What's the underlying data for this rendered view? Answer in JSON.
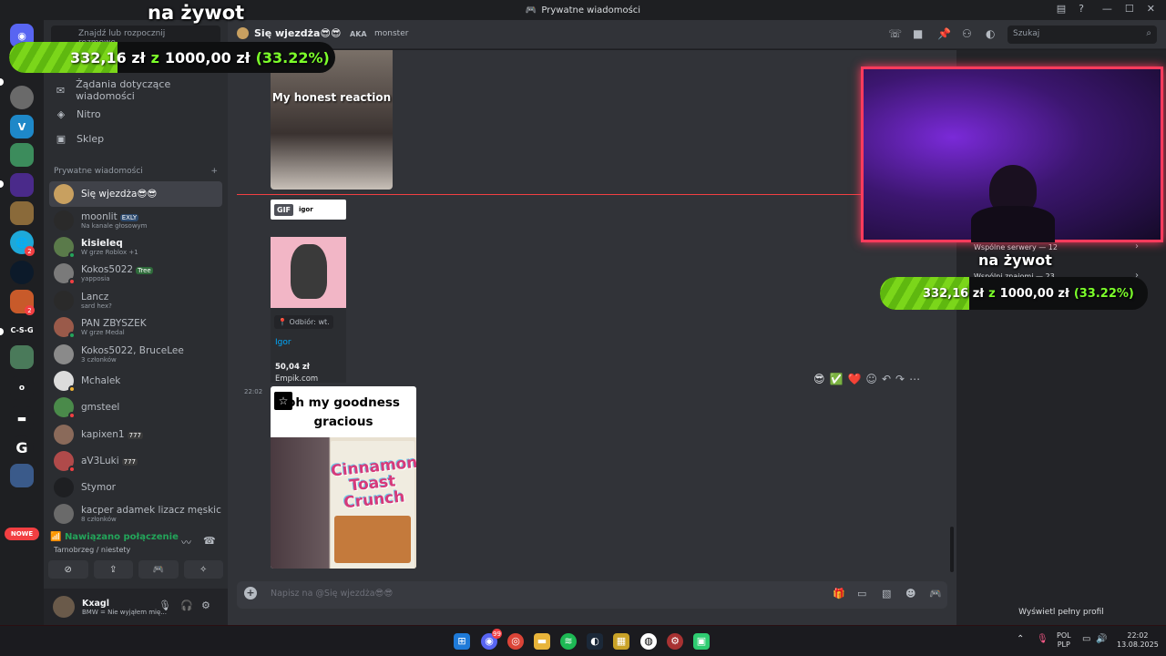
{
  "window": {
    "title": "Prywatne wiadomości"
  },
  "sidebar": {
    "search_placeholder": "Znajdź lub rozpocznij rozmowę",
    "nav": [
      {
        "label": "Żądania dotyczące wiadomości"
      },
      {
        "label": "Nitro"
      },
      {
        "label": "Sklep"
      }
    ],
    "section_title": "Prywatne wiadomości",
    "add_icon": "+",
    "dms": [
      {
        "name": "Się wjezdża😎😎",
        "sub": ""
      },
      {
        "name": "moonlit",
        "tag": "EXLY",
        "sub": "Na kanale głosowym"
      },
      {
        "name": "kisieleq",
        "sub": "W grze Roblox +1"
      },
      {
        "name": "Kokos5022",
        "tag": "Tree",
        "sub": "yapposia"
      },
      {
        "name": "Lancz",
        "sub": "sard hex?"
      },
      {
        "name": "PAN ZBYSZEK",
        "sub": "W grze Medal"
      },
      {
        "name": "Kokos5022, BruceLee",
        "sub": "3 członków"
      },
      {
        "name": "Mchalek",
        "sub": ""
      },
      {
        "name": "gmsteel",
        "sub": ""
      },
      {
        "name": "kapixen1",
        "tag": "777",
        "sub": ""
      },
      {
        "name": "aV3Luki",
        "tag": "777",
        "sub": ""
      },
      {
        "name": "Stymor",
        "sub": ""
      },
      {
        "name": "kacper adamek lizacz męskic...",
        "sub": "8 członków"
      }
    ],
    "voice": {
      "status": "Nawiązano połączenie",
      "location": "Tarnobrzeg / niestety"
    },
    "user": {
      "name": "Kxagl",
      "status": "BMW = Nie wyjąłem mię..."
    }
  },
  "rail": {
    "badge_label": "NOWE",
    "badges": [
      "2",
      "2"
    ],
    "labels": [
      "C-S-G",
      "o"
    ]
  },
  "chat": {
    "header": {
      "name": "Się wjezdża😎😎",
      "aka_label": "AKA",
      "aka_name": "monster",
      "search_placeholder": "Szukaj"
    },
    "messages": {
      "meme1_caption": "My honest reaction",
      "gif_label": "GIF",
      "gif_name": "igor",
      "embed": {
        "pickup": "Odbiór: wt.",
        "link": "Igor",
        "price": "50,04 zł",
        "shop": "Empik.com"
      },
      "timestamp": "22:02",
      "meme2_caption": "oh my goodness gracious",
      "cereal_text": "Cinnamon Toast Crunch"
    },
    "reactions": [
      "😎",
      "✅",
      "❤️"
    ],
    "composer_placeholder": "Napisz na @Się wjezdża😎😎"
  },
  "profile": {
    "mutual_servers": "Wspólne serwery — 12",
    "mutual_friends": "Wspólni znajomi — 23",
    "full_profile": "Wyświetl pełny profil"
  },
  "overlay": {
    "live_label": "na żywot",
    "current": "332,16 zł",
    "of": "z",
    "goal": "1000,00 zł",
    "percent_text": "(33.22%)",
    "progress": 0.3322
  },
  "taskbar": {
    "lang_top": "POL",
    "lang_bottom": "PLP",
    "time": "22:02",
    "date": "13.08.2025",
    "discord_badge": "99"
  }
}
